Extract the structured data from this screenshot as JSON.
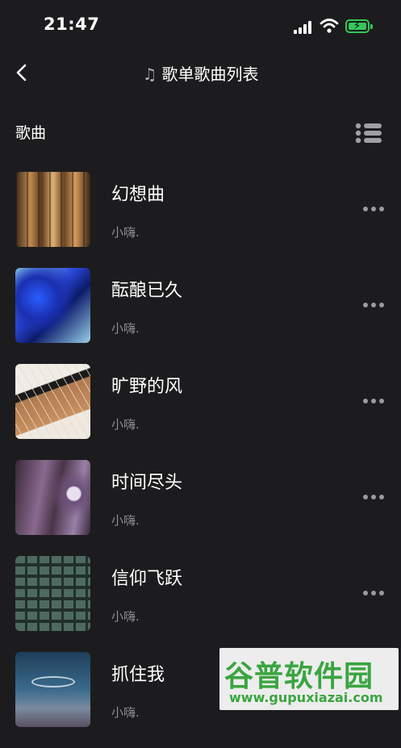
{
  "status_bar": {
    "time": "21:47"
  },
  "nav": {
    "title_icon": "♫",
    "title": "歌单歌曲列表"
  },
  "section": {
    "header": "歌曲"
  },
  "songs": [
    {
      "title": "幻想曲",
      "artist": "小嗨."
    },
    {
      "title": "酝酿已久",
      "artist": "小嗨."
    },
    {
      "title": "旷野的风",
      "artist": "小嗨."
    },
    {
      "title": "时间尽头",
      "artist": "小嗨."
    },
    {
      "title": "信仰飞跃",
      "artist": "小嗨."
    },
    {
      "title": "抓住我",
      "artist": "小嗨."
    }
  ],
  "watermark": {
    "title": "谷普软件园",
    "url": "www.gupuxiazai.com"
  },
  "colors": {
    "background": "#1c1c1e",
    "battery": "#34c759",
    "muted_text": "#8e8e93",
    "watermark": "#3aa540"
  }
}
